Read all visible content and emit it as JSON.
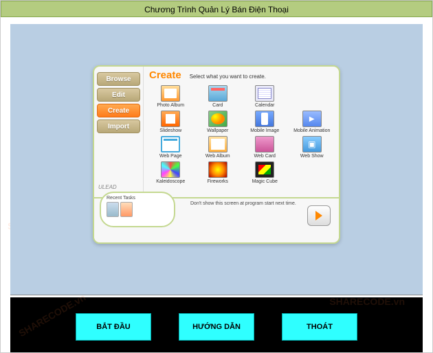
{
  "window": {
    "title": "Chương Trình Quản Lý Bán Điện Thoại"
  },
  "watermark": "SHARECODE.vn",
  "dialog": {
    "tabs": {
      "browse": "Browse",
      "edit": "Edit",
      "create": "Create",
      "import": "Import"
    },
    "brand": "ULEAD",
    "header": {
      "title": "Create",
      "subtitle": "Select what you want to create."
    },
    "items": [
      {
        "label": "Photo Album"
      },
      {
        "label": "Card"
      },
      {
        "label": "Calendar"
      },
      {
        "label": ""
      },
      {
        "label": "Slideshow"
      },
      {
        "label": "Wallpaper"
      },
      {
        "label": "Mobile Image"
      },
      {
        "label": "Mobile Animation"
      },
      {
        "label": "Web Page"
      },
      {
        "label": "Web Album"
      },
      {
        "label": "Web Card"
      },
      {
        "label": "Web Show"
      },
      {
        "label": "Kaleidoscope"
      },
      {
        "label": "Fireworks"
      },
      {
        "label": "Magic Cube"
      },
      {
        "label": ""
      }
    ],
    "recent_title": "Recent Tasks",
    "startup_hint": "Don't show this screen at program start next time."
  },
  "buttons": {
    "start": "BẮT ĐẦU",
    "guide": "HƯỚNG DẪN",
    "exit": "THOÁT"
  }
}
